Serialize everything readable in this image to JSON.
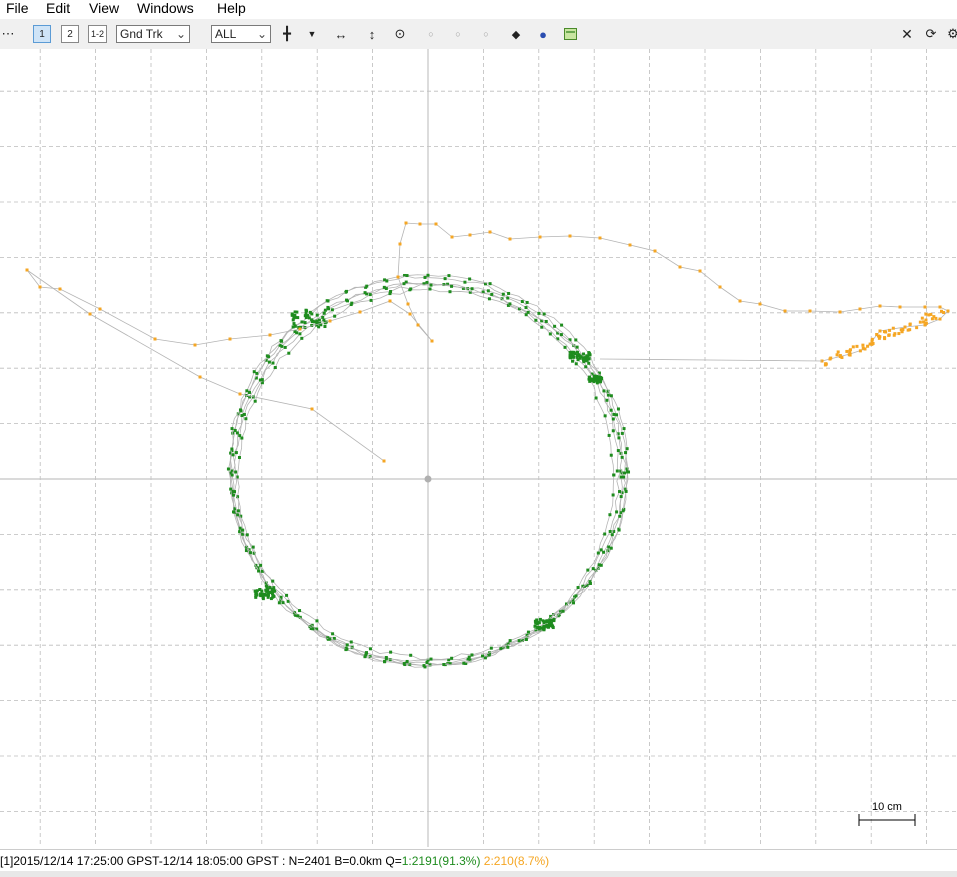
{
  "menu": [
    "File",
    "Edit",
    "View",
    "Windows",
    "Help"
  ],
  "toolbar": {
    "btn1": "1",
    "btn2": "2",
    "btn12": "1-2",
    "plot_type": "Gnd Trk",
    "filter": "ALL"
  },
  "colors": {
    "q1": "#1e8c1e",
    "q2": "#f5a623",
    "track": "#b4b4b4",
    "grid": "#bcbcbc"
  },
  "scale_label": "10 cm",
  "status": {
    "prefix": "[1]2015/12/14 17:25:00 GPST-12/14 18:05:00 GPST : N=2401 B=0.0km Q=",
    "q1": "1:2191(91.3%)",
    "q2": "2:210(8.7%)"
  }
}
